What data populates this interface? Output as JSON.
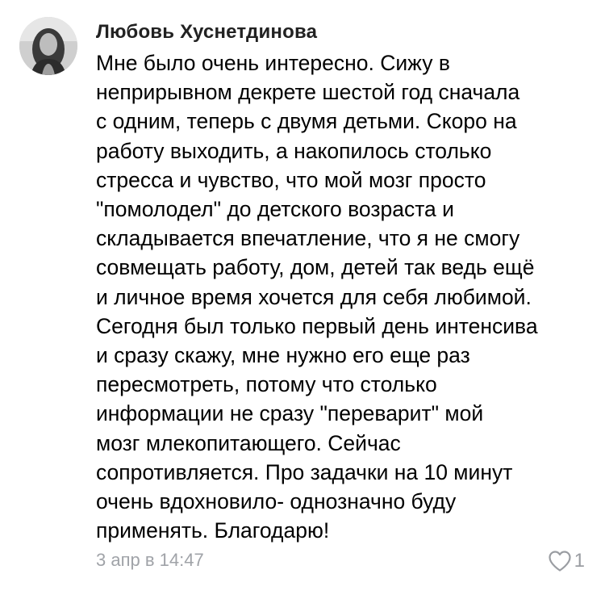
{
  "comment": {
    "author": "Любовь Хуснетдинова",
    "text_lines": [
      "Мне было очень интересно. Сижу в",
      "неприрывном декрете шестой год сначала",
      "с одним, теперь с двумя детьми. Скоро на",
      "работу выходить, а накопилось столько",
      "стресса и чувство, что мой мозг просто",
      "\"помолодел\" до детского возраста и",
      "складывается впечатление, что я не смогу",
      "совмещать работу, дом, детей так ведь ещё",
      "и личное время хочется для себя любимой.",
      "Сегодня был только первый день интенсива",
      "и сразу скажу, мне нужно его еще раз",
      "пересмотреть, потому что столько",
      "информации не сразу \"переварит\" мой",
      "мозг млекопитающего. Сейчас",
      "сопротивляется. Про задачки на 10 минут",
      "очень вдохновило- однозначно буду",
      "применять. Благодарю!"
    ],
    "date": "3 апр в 14:47",
    "like_count": "1",
    "like_icon": "heart-outline-icon",
    "colors": {
      "author": "#222222",
      "text": "#000000",
      "meta": "#a0a3a8"
    }
  }
}
